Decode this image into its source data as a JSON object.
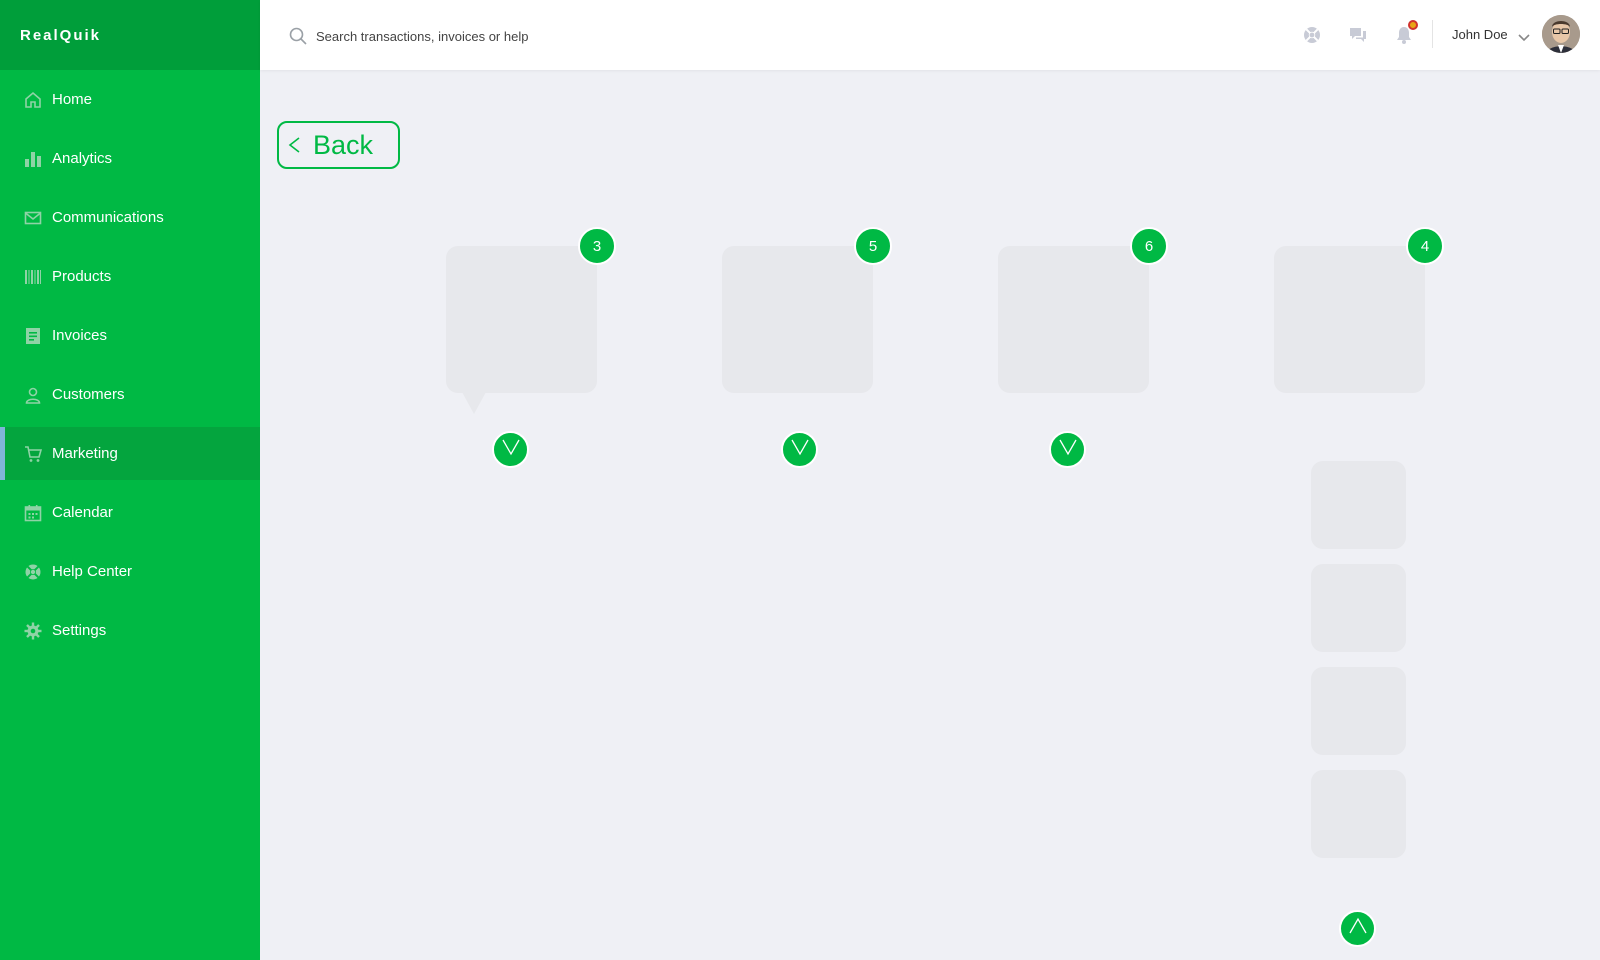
{
  "brand": {
    "name": "RealQuik"
  },
  "sidebar": {
    "items": [
      {
        "label": "Home",
        "icon": "home-icon"
      },
      {
        "label": "Analytics",
        "icon": "bar-chart-icon"
      },
      {
        "label": "Communications",
        "icon": "mail-icon"
      },
      {
        "label": "Products",
        "icon": "barcode-icon"
      },
      {
        "label": "Invoices",
        "icon": "invoice-icon"
      },
      {
        "label": "Customers",
        "icon": "user-icon"
      },
      {
        "label": "Marketing",
        "icon": "cart-icon",
        "active": true
      },
      {
        "label": "Calendar",
        "icon": "calendar-icon"
      },
      {
        "label": "Help Center",
        "icon": "lifebuoy-icon"
      },
      {
        "label": "Settings",
        "icon": "gear-icon"
      }
    ]
  },
  "topbar": {
    "search_placeholder": "Search transactions, invoices or help",
    "user_name": "John Doe"
  },
  "back_button": {
    "label": "Back"
  },
  "cards": [
    {
      "count": "3"
    },
    {
      "count": "5"
    },
    {
      "count": "6"
    },
    {
      "count": "4"
    }
  ],
  "colors": {
    "accent": "#00b944",
    "sidebar_header": "#009e3a",
    "sidebar_active": "#04a53e",
    "background": "#eff0f5",
    "card": "#e7e8ec"
  }
}
